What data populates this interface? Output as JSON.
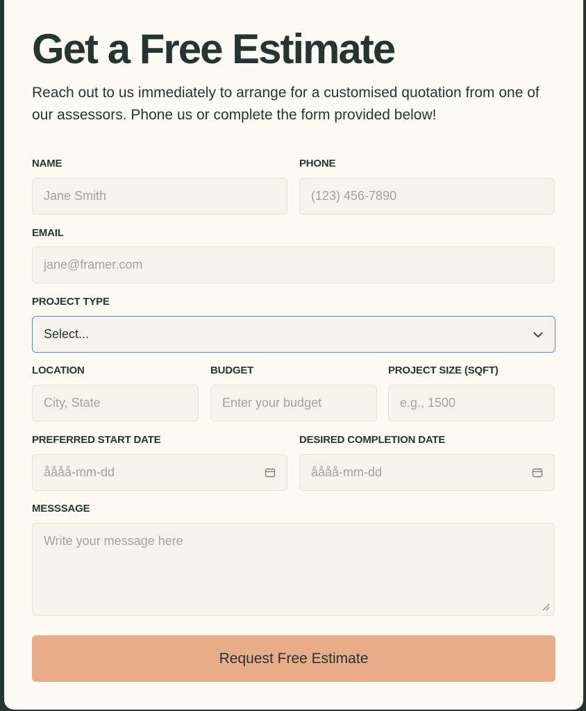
{
  "header": {
    "title": "Get a Free Estimate",
    "intro": "Reach out to us immediately to arrange for a customised quotation from one of our assessors. Phone us or complete the form provided below!"
  },
  "form": {
    "name": {
      "label": "NAME",
      "placeholder": "Jane Smith"
    },
    "phone": {
      "label": "PHONE",
      "placeholder": "(123) 456-7890"
    },
    "email": {
      "label": "EMAIL",
      "placeholder": "jane@framer.com"
    },
    "project_type": {
      "label": "PROJECT TYPE",
      "selected": "Select..."
    },
    "location": {
      "label": "LOCATION",
      "placeholder": "City, State"
    },
    "budget": {
      "label": "BUDGET",
      "placeholder": "Enter your budget"
    },
    "project_size": {
      "label": "PROJECT SIZE (SQFT)",
      "placeholder": "e.g., 1500"
    },
    "start_date": {
      "label": "PREFERRED START DATE",
      "placeholder": "åååå-mm-dd"
    },
    "completion_date": {
      "label": "DESIRED COMPLETION DATE",
      "placeholder": "åååå-mm-dd"
    },
    "message": {
      "label": "MESSSAGE",
      "placeholder": "Write your message here"
    },
    "submit_label": "Request Free Estimate"
  },
  "icons": {
    "select": "chevron-down-icon",
    "date": "calendar-icon",
    "resize": "resize-handle-icon"
  },
  "colors": {
    "page_background": "#253531",
    "card_background": "#fdfbf2",
    "text": "#253531",
    "input_background": "#f5f3ea",
    "input_border": "#e5e2d6",
    "focus_border": "#4f8fd8",
    "accent_button": "#e8ad88",
    "placeholder": "#a3a49f"
  }
}
